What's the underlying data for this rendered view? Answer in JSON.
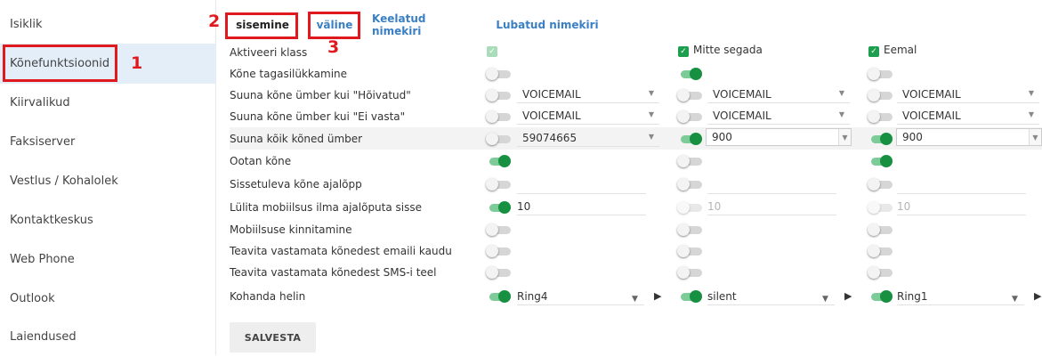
{
  "sidebar": {
    "items": [
      {
        "label": "Isiklik"
      },
      {
        "label": "Kõnefunktsioonid"
      },
      {
        "label": "Kiirvalikud"
      },
      {
        "label": "Faksiserver"
      },
      {
        "label": "Vestlus / Kohalolek"
      },
      {
        "label": "Kontaktkeskus"
      },
      {
        "label": "Web Phone"
      },
      {
        "label": "Outlook"
      },
      {
        "label": "Laiendused"
      }
    ],
    "active_index": 1
  },
  "annotations": {
    "n1": "1",
    "n2": "2",
    "n3": "3"
  },
  "tabs": [
    {
      "label": "sisemine"
    },
    {
      "label": "väline"
    },
    {
      "label": "Keelatud nimekiri"
    },
    {
      "label": "Lubatud nimekiri"
    }
  ],
  "columns": [
    {
      "header": ""
    },
    {
      "header": "Mitte segada"
    },
    {
      "header": "Eemal"
    }
  ],
  "rows": {
    "activate": {
      "label": "Aktiveeri klass"
    },
    "rejection": {
      "label": "Kõne tagasilükkamine",
      "toggles": [
        false,
        true,
        false
      ]
    },
    "busy": {
      "label": "Suuna kõne ümber kui \"Hõivatud\"",
      "toggles": [
        false,
        false,
        false
      ],
      "values": [
        "VOICEMAIL",
        "VOICEMAIL",
        "VOICEMAIL"
      ]
    },
    "noanswer": {
      "label": "Suuna kõne ümber kui \"Ei vasta\"",
      "toggles": [
        false,
        false,
        false
      ],
      "values": [
        "VOICEMAIL",
        "VOICEMAIL",
        "VOICEMAIL"
      ]
    },
    "all": {
      "label": "Suuna kõik kõned ümber",
      "toggles": [
        false,
        true,
        true
      ],
      "values": [
        "59074665",
        "900",
        "900"
      ]
    },
    "waiting": {
      "label": "Ootan kõne",
      "toggles": [
        true,
        false,
        true
      ]
    },
    "timeout": {
      "label": "Sissetuleva kõne ajalõpp",
      "toggles": [
        false,
        false,
        false
      ]
    },
    "mobility": {
      "label": "Lülita mobiilsus ilma ajalõputa sisse",
      "toggles": [
        true,
        false,
        false
      ],
      "values": [
        "10",
        "10",
        "10"
      ]
    },
    "mobconfirm": {
      "label": "Mobiilsuse kinnitamine",
      "toggles": [
        false,
        false,
        false
      ]
    },
    "email": {
      "label": "Teavita vastamata kõnedest emaili kaudu",
      "toggles": [
        false,
        false,
        false
      ]
    },
    "sms": {
      "label": "Teavita vastamata kõnedest SMS-i teel",
      "toggles": [
        false,
        false,
        false
      ]
    },
    "ring": {
      "label": "Kohanda helin",
      "toggles": [
        true,
        true,
        true
      ],
      "values": [
        "Ring4",
        "silent",
        "Ring1"
      ]
    }
  },
  "save_label": "SALVESTA",
  "colors": {
    "accent_green": "#179141",
    "link_blue": "#3a7fc4",
    "annotation_red": "#e0191e",
    "active_sidebar": "#e4eef8"
  }
}
